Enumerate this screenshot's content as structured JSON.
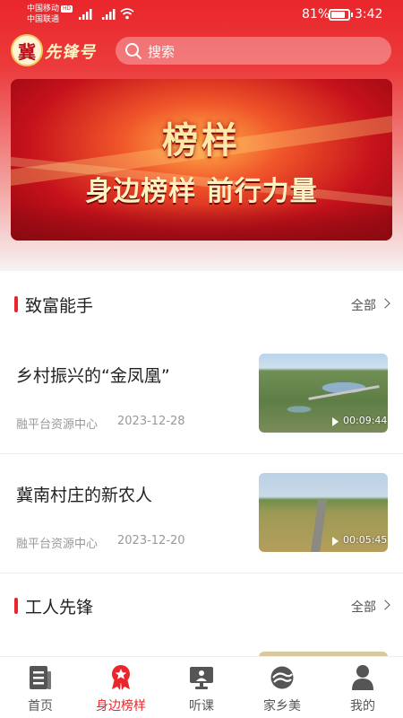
{
  "status_bar": {
    "carrier1": "中国移动",
    "carrier1_badge": "HD",
    "carrier2": "中国联通",
    "battery": "81%",
    "time": "3:42"
  },
  "header": {
    "logo_char": "冀",
    "logo_text": "先锋号",
    "search_placeholder": "搜索"
  },
  "banner": {
    "title": "榜样",
    "subtitle": "身边榜样  前行力量"
  },
  "sections": [
    {
      "title": "致富能手",
      "more": "全部",
      "articles": [
        {
          "title": "乡村振兴的“金凤凰”",
          "source": "融平台资源中心",
          "date": "2023-12-28",
          "duration": "00:09:44"
        },
        {
          "title": "冀南村庄的新农人",
          "source": "融平台资源中心",
          "date": "2023-12-20",
          "duration": "00:05:45"
        }
      ]
    },
    {
      "title": "工人先锋",
      "more": "全部"
    }
  ],
  "tabbar": {
    "items": [
      {
        "label": "首页",
        "icon": "news-icon"
      },
      {
        "label": "身边榜样",
        "icon": "medal-star-icon",
        "active": true
      },
      {
        "label": "听课",
        "icon": "lecture-screen-icon"
      },
      {
        "label": "家乡美",
        "icon": "landscape-icon"
      },
      {
        "label": "我的",
        "icon": "person-icon"
      }
    ]
  },
  "colors": {
    "accent": "#e8262b",
    "header_red": "#e9262b"
  }
}
